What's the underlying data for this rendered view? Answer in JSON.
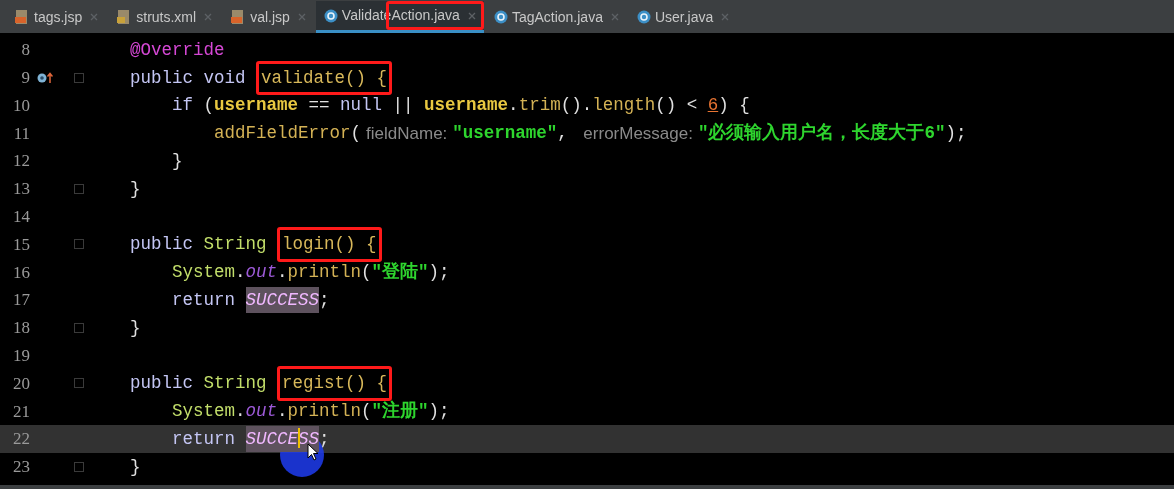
{
  "tabs": [
    {
      "label": "tags.jsp",
      "kind": "jsp",
      "selected": false
    },
    {
      "label": "struts.xml",
      "kind": "xml",
      "selected": false
    },
    {
      "label": "val.jsp",
      "kind": "jsp",
      "selected": false
    },
    {
      "label": "ValidateAction.java",
      "kind": "class",
      "selected": true,
      "boxed": true
    },
    {
      "label": "TagAction.java",
      "kind": "class",
      "selected": false
    },
    {
      "label": "User.java",
      "kind": "class",
      "selected": false
    }
  ],
  "lines": [
    {
      "number": "8",
      "tokens": [
        {
          "kind": "annotation",
          "text": "@Override"
        }
      ]
    },
    {
      "number": "9",
      "override_marker": true,
      "foldable": true,
      "tokens": [
        {
          "kind": "keyword",
          "text": "public void "
        },
        {
          "kind": "method",
          "text": "validate() {",
          "boxed": true
        }
      ],
      "children": [
        {
          "number": "10",
          "tokens": [
            {
              "kind": "keyword",
              "text": "if "
            },
            {
              "kind": "plain",
              "text": "("
            },
            {
              "kind": "field",
              "text": "username"
            },
            {
              "kind": "plain",
              "text": " == "
            },
            {
              "kind": "keyword",
              "text": "null"
            },
            {
              "kind": "plain",
              "text": " || "
            },
            {
              "kind": "field",
              "text": "username"
            },
            {
              "kind": "plain",
              "text": "."
            },
            {
              "kind": "call",
              "text": "trim"
            },
            {
              "kind": "plain",
              "text": "()."
            },
            {
              "kind": "call",
              "text": "length"
            },
            {
              "kind": "plain",
              "text": "() < "
            },
            {
              "kind": "number",
              "text": "6"
            },
            {
              "kind": "plain",
              "text": ") {"
            }
          ],
          "children": [
            {
              "number": "11",
              "tokens": [
                {
                  "kind": "call",
                  "text": "addFieldError"
                },
                {
                  "kind": "plain",
                  "text": "("
                },
                {
                  "kind": "hint",
                  "text": "fieldName:"
                },
                {
                  "kind": "string",
                  "text": "″username″"
                },
                {
                  "kind": "plain",
                  "text": ", "
                },
                {
                  "kind": "hint",
                  "text": "errorMessage:"
                },
                {
                  "kind": "string",
                  "text": "″必须输入用户名，长度大于6″"
                },
                {
                  "kind": "plain",
                  "text": ");"
                }
              ]
            }
          ]
        },
        {
          "number": "12",
          "tokens": [
            {
              "kind": "plain",
              "text": "}"
            }
          ]
        }
      ]
    },
    {
      "number": "13",
      "foldable": true,
      "tokens": [
        {
          "kind": "plain",
          "text": "}"
        }
      ]
    },
    {
      "number": "14"
    },
    {
      "number": "15",
      "foldable": true,
      "tokens": [
        {
          "kind": "keyword",
          "text": "public "
        },
        {
          "kind": "type",
          "text": "String "
        },
        {
          "kind": "method",
          "text": "login() {",
          "boxed": true
        }
      ],
      "children": [
        {
          "number": "16",
          "tokens": [
            {
              "kind": "type",
              "text": "System"
            },
            {
              "kind": "plain",
              "text": "."
            },
            {
              "kind": "static",
              "text": "out"
            },
            {
              "kind": "plain",
              "text": "."
            },
            {
              "kind": "call",
              "text": "println"
            },
            {
              "kind": "plain",
              "text": "("
            },
            {
              "kind": "string",
              "text": "″登陆″"
            },
            {
              "kind": "plain",
              "text": ");"
            }
          ]
        },
        {
          "number": "17",
          "tokens": [
            {
              "kind": "keyword",
              "text": "return "
            },
            {
              "kind": "constant",
              "text": "SUCCESS"
            },
            {
              "kind": "plain",
              "text": ";"
            }
          ]
        }
      ]
    },
    {
      "number": "18",
      "foldable": true,
      "tokens": [
        {
          "kind": "plain",
          "text": "}"
        }
      ]
    },
    {
      "number": "19"
    },
    {
      "number": "20",
      "foldable": true,
      "tokens": [
        {
          "kind": "keyword",
          "text": "public "
        },
        {
          "kind": "type",
          "text": "String "
        },
        {
          "kind": "method",
          "text": "regist() {",
          "boxed": true
        }
      ],
      "children": [
        {
          "number": "21",
          "tokens": [
            {
              "kind": "type",
              "text": "System"
            },
            {
              "kind": "plain",
              "text": "."
            },
            {
              "kind": "static",
              "text": "out"
            },
            {
              "kind": "plain",
              "text": "."
            },
            {
              "kind": "call",
              "text": "println"
            },
            {
              "kind": "plain",
              "text": "("
            },
            {
              "kind": "string",
              "text": "″注册″"
            },
            {
              "kind": "plain",
              "text": ");"
            }
          ]
        },
        {
          "number": "22",
          "current": true,
          "tokens": [
            {
              "kind": "keyword",
              "text": "return "
            },
            {
              "kind": "constant",
              "text": "SUCCESS",
              "caret": true
            },
            {
              "kind": "plain",
              "text": ";"
            }
          ]
        }
      ]
    },
    {
      "number": "23",
      "foldable": true,
      "tokens": [
        {
          "kind": "plain",
          "text": "}"
        }
      ]
    }
  ]
}
